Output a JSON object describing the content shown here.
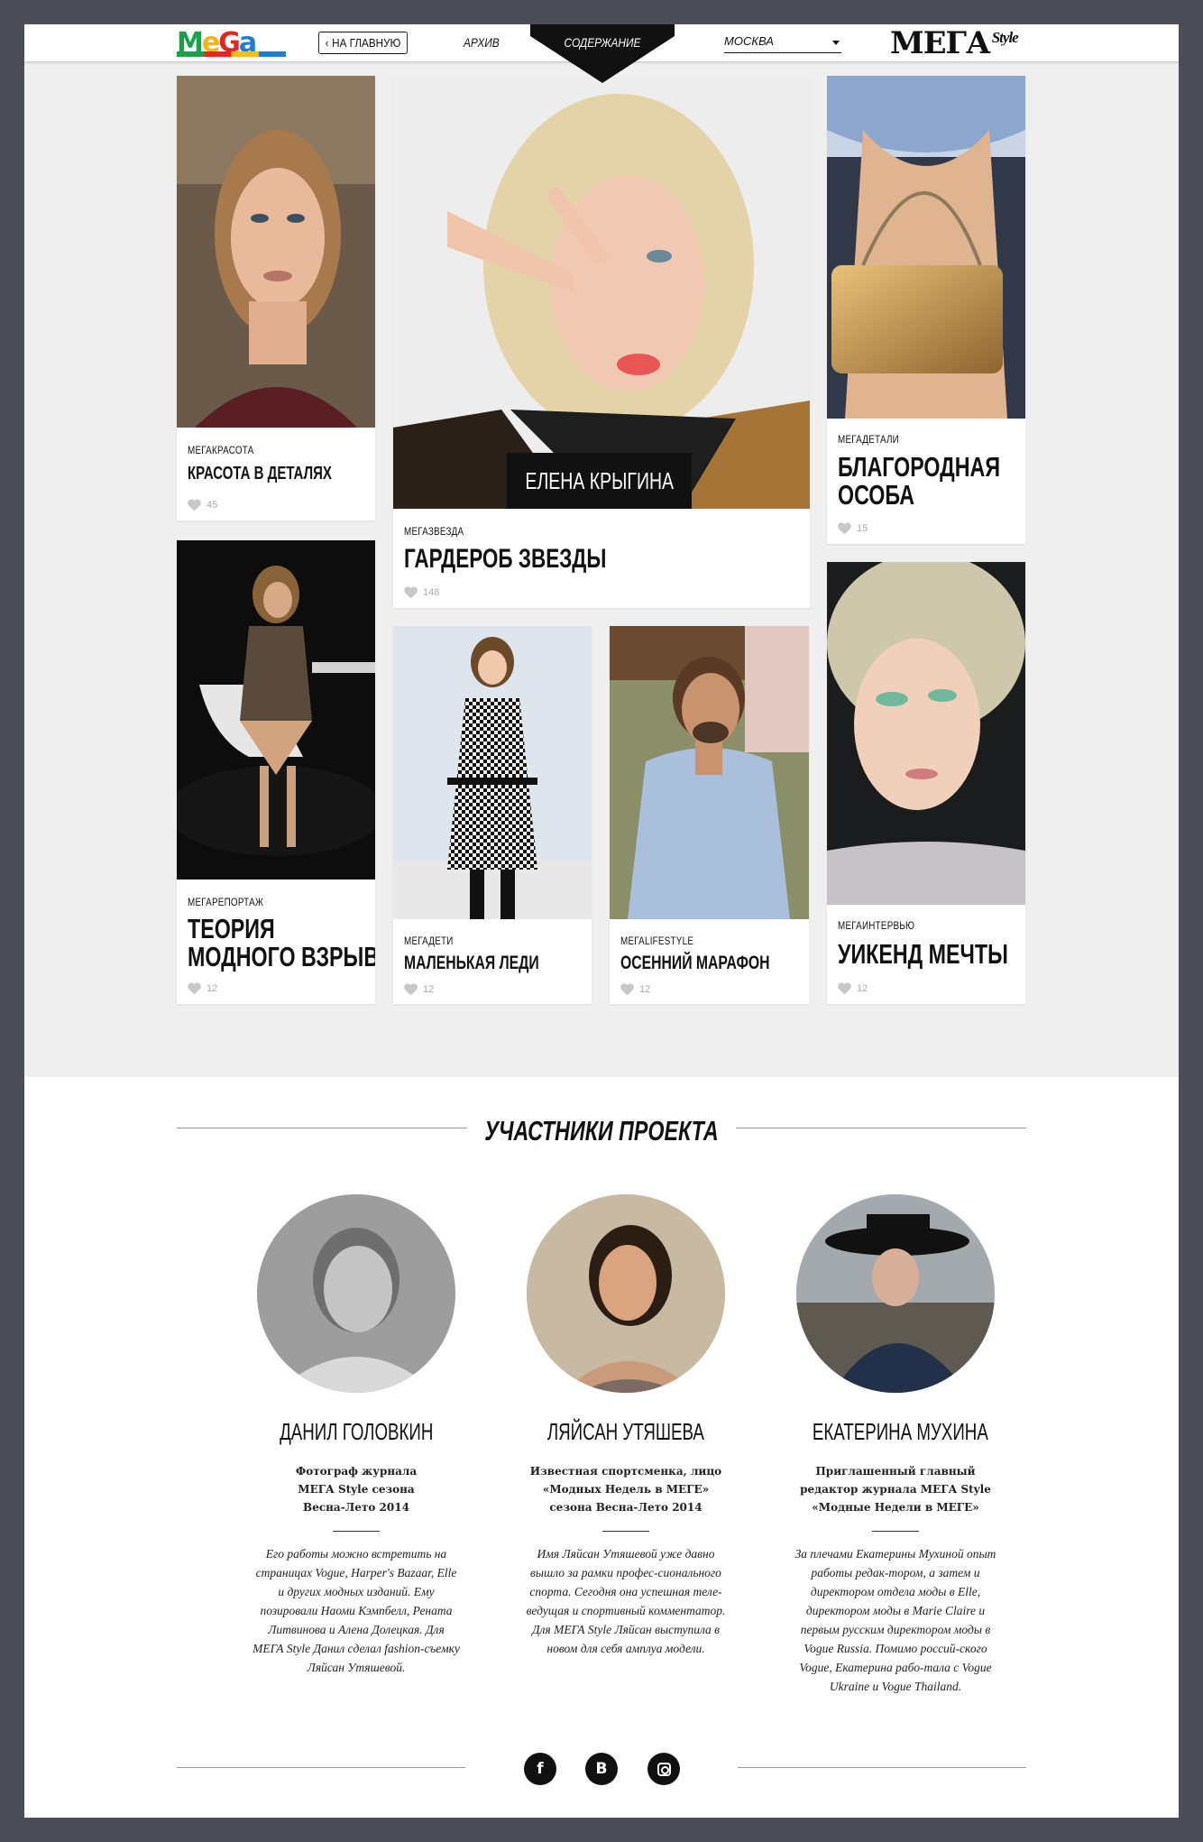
{
  "header": {
    "logo": "MeGa",
    "home_button": "НА ГЛАВНУЮ",
    "nav_archive": "АРХИВ",
    "nav_contents": "СОДЕРЖАНИЕ",
    "city": "МОСКВА",
    "brand": "МЕГА",
    "brand_sub": "Style"
  },
  "cards": [
    {
      "category": "МЕГАКРАСОТА",
      "title": "КРАСОТА В ДЕТАЛЯХ",
      "likes": "45"
    },
    {
      "category": "МЕГАЗВЕЗДА",
      "title": "ГАРДЕРОБ ЗВЕЗДЫ",
      "likes": "148",
      "tag": "ЕЛЕНА КРЫГИНА"
    },
    {
      "category": "МЕГАДЕТАЛИ",
      "title_line1": "БЛАГОРОДНАЯ",
      "title_line2": "ОСОБА",
      "likes": "15"
    },
    {
      "category": "МЕГАРЕПОРТАЖ",
      "title_line1": "ТЕОРИЯ",
      "title_line2": "МОДНОГО ВЗРЫВА",
      "likes": "12"
    },
    {
      "category": "МЕГАДЕТИ",
      "title": "МАЛЕНЬКАЯ ЛЕДИ",
      "likes": "12"
    },
    {
      "category": "МЕГАLIFESTYLE",
      "title": "ОСЕННИЙ МАРАФОН",
      "likes": "12"
    },
    {
      "category": "МЕГАИНТЕРВЬЮ",
      "title": "УИКЕНД МЕЧТЫ",
      "likes": "12"
    }
  ],
  "participants": {
    "title": "УЧАСТНИКИ ПРОЕКТА",
    "people": [
      {
        "name": "ДАНИЛ ГОЛОВКИН",
        "role": "Фотограф журнала\nМЕГА Style сезона\nВесна-Лето 2014",
        "desc": "Его работы можно встретить на страницах Vogue, Harper's Bazaar, Elle и других модных изданий. Ему позировали Наоми Кэмпбелл, Рената Литвинова и Алена Долецкая. Для МЕГА Style Данил сделал fashion-съемку Ляйсан Утяшевой."
      },
      {
        "name": "ЛЯЙСАН УТЯШЕВА",
        "role": "Известная спортсменка, лицо\n«Модных Недель в МЕГЕ»\nсезона Весна-Лето 2014",
        "desc": "Имя Ляйсан Утяшевой уже давно вышло за рамки профес-сионального спорта. Сегодня она успешная теле- ведущая и спортивный комментатор. Для МЕГА Style Ляйсан выступила в новом для себя амплуа модели."
      },
      {
        "name": "ЕКАТЕРИНА МУХИНА",
        "role": "Приглашенный главный\nредактор журнала МЕГА Style\n«Модные Недели в МЕГЕ»",
        "desc": "За плечами Екатерины Мухиной опыт работы редак-тором, а затем и директором отдела моды в Elle, директором моды в Marie Claire и первым русским директором моды в Vogue Russia. Помимо россий-ского Vogue, Екатерина рабо-тала с Vogue Ukraine и Vogue Thailand."
      }
    ]
  },
  "social": {
    "facebook": "f",
    "vkontakte": "B",
    "instagram": "instagram-icon"
  }
}
